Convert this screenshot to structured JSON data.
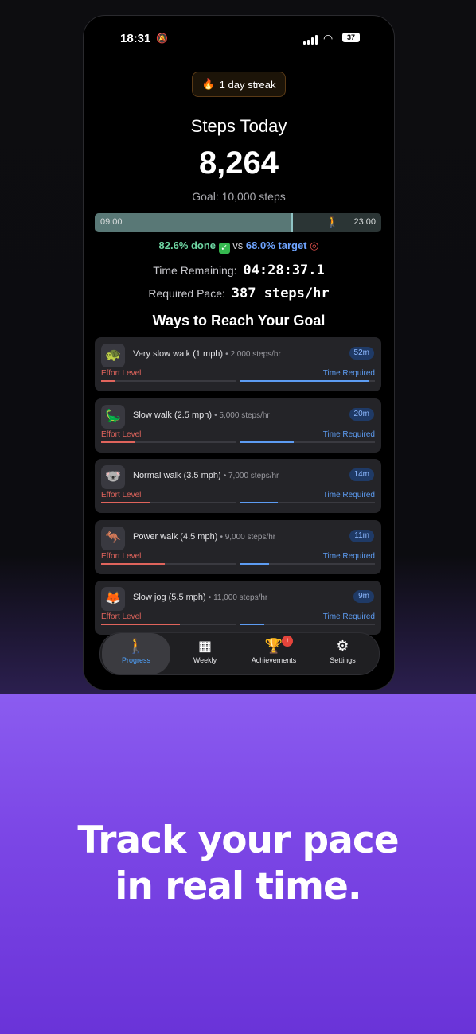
{
  "status_bar": {
    "time": "18:31",
    "battery": "37"
  },
  "streak": {
    "label": "1 day streak"
  },
  "header": {
    "title": "Steps Today",
    "steps": "8,264",
    "goal": "Goal: 10,000 steps"
  },
  "progress": {
    "start": "09:00",
    "end": "23:00",
    "done_fraction": 0.686,
    "marker_fraction": 0.68
  },
  "status_line": {
    "done": "82.6% done",
    "vs": "vs",
    "target": "68.0% target"
  },
  "stats": {
    "time_remaining_label": "Time Remaining:",
    "time_remaining_value": "04:28:37.1",
    "required_pace_label": "Required Pace:",
    "required_pace_value": "387 steps/hr"
  },
  "ways_title": "Ways to Reach Your Goal",
  "cards": [
    {
      "name": "Very slow walk (1 mph)",
      "rate": "2,000 steps/hr",
      "time": "52m",
      "icon": "turtle-icon",
      "glyph": "🐢",
      "effort": 0.1,
      "time_fraction": 0.95,
      "effort_label": "Effort Level",
      "time_label": "Time Required"
    },
    {
      "name": "Slow walk (2.5 mph)",
      "rate": "5,000 steps/hr",
      "time": "20m",
      "icon": "dinosaur-icon",
      "glyph": "🦕",
      "effort": 0.25,
      "time_fraction": 0.4,
      "effort_label": "Effort Level",
      "time_label": "Time Required"
    },
    {
      "name": "Normal walk (3.5 mph)",
      "rate": "7,000 steps/hr",
      "time": "14m",
      "icon": "koala-icon",
      "glyph": "🐨",
      "effort": 0.36,
      "time_fraction": 0.28,
      "effort_label": "Effort Level",
      "time_label": "Time Required"
    },
    {
      "name": "Power walk (4.5 mph)",
      "rate": "9,000 steps/hr",
      "time": "11m",
      "icon": "kangaroo-icon",
      "glyph": "🦘",
      "effort": 0.47,
      "time_fraction": 0.22,
      "effort_label": "Effort Level",
      "time_label": "Time Required"
    },
    {
      "name": "Slow jog (5.5 mph)",
      "rate": "11,000 steps/hr",
      "time": "9m",
      "icon": "fox-icon",
      "glyph": "🦊",
      "effort": 0.58,
      "time_fraction": 0.18,
      "effort_label": "Effort Level",
      "time_label": "Time Required"
    }
  ],
  "tabs": [
    {
      "label": "Progress",
      "icon": "walking-icon",
      "active": true
    },
    {
      "label": "Weekly",
      "icon": "calendar-icon",
      "active": false
    },
    {
      "label": "Achievements",
      "icon": "trophy-icon",
      "active": false,
      "badge": "!"
    },
    {
      "label": "Settings",
      "icon": "settings-icon",
      "active": false
    }
  ],
  "promo": {
    "line1": "Track your pace",
    "line2": "in real time."
  },
  "colors": {
    "accent": "#4fa3ff",
    "effort": "#e0645c",
    "time": "#5d9cf2",
    "done": "#6ed6a2",
    "promo": "#7c47e6"
  }
}
